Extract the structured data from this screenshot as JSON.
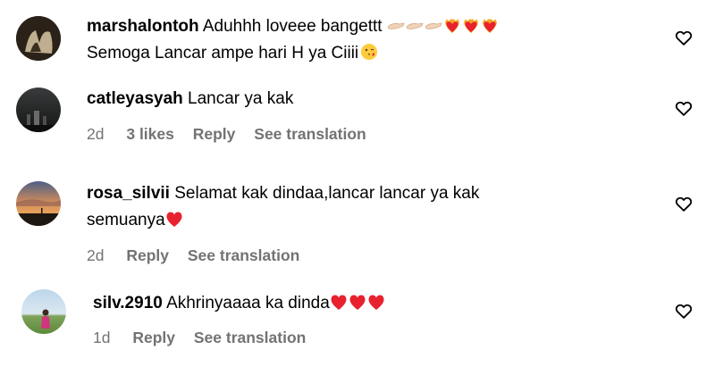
{
  "comments": [
    {
      "username": "marshalontoh",
      "line1": "Aduhhh loveee bangettt",
      "line2": "Semoga Lancar ampe hari H ya Ciiii",
      "emoji_line1": [
        "pinching-hand",
        "pinching-hand",
        "pinching-hand",
        "heart-on-fire",
        "heart-on-fire",
        "heart-on-fire"
      ],
      "emoji_line2": [
        "face-blowing-kiss"
      ]
    },
    {
      "username": "catleyasyah",
      "line1": "Lancar ya kak",
      "time": "2d",
      "likes": "3 likes",
      "reply": "Reply",
      "translate": "See translation"
    },
    {
      "username": "rosa_silvii",
      "line1": "Selamat kak dindaa,lancar lancar ya kak",
      "line2": "semuanya",
      "emoji_line2": [
        "red-heart"
      ],
      "time": "2d",
      "reply": "Reply",
      "translate": "See translation"
    },
    {
      "username": "silv.2910",
      "line1": "Akhrinyaaaa ka dinda",
      "emoji_line1": [
        "red-heart",
        "red-heart",
        "red-heart"
      ],
      "time": "1d",
      "reply": "Reply",
      "translate": "See translation"
    }
  ],
  "colors": {
    "text": "#000000",
    "meta": "#737373",
    "heart_emoji": "#e8212f"
  }
}
